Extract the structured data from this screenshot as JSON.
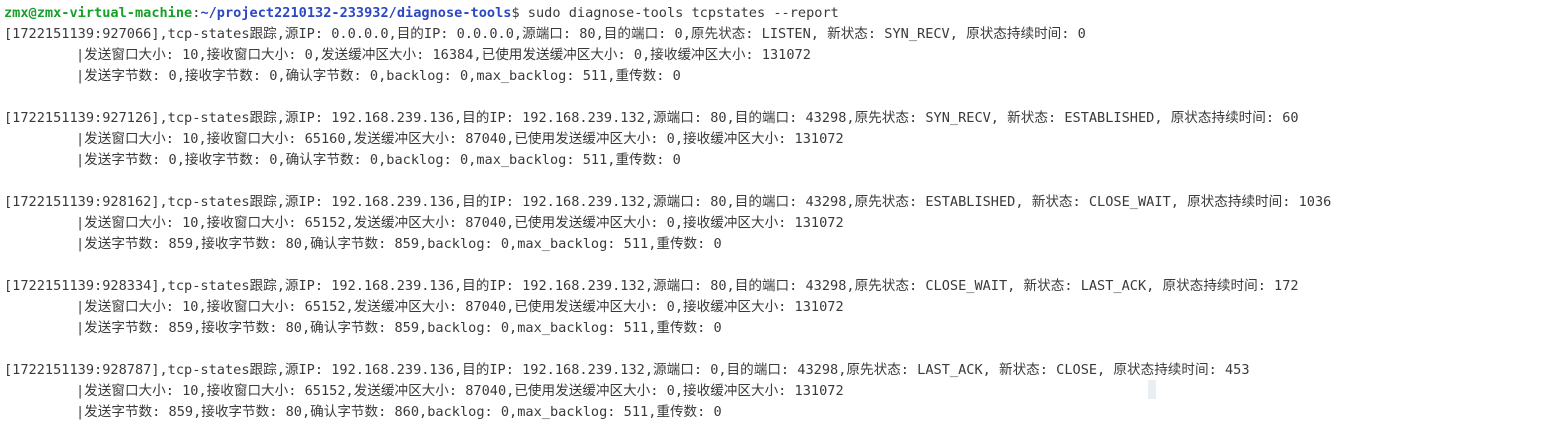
{
  "prompt": {
    "user_host": "zmx@zmx-virtual-machine",
    "separator": ":",
    "path": "~/project2210132-233932/diagnose-tools",
    "dollar": "$",
    "command": " sudo diagnose-tools tcpstates --report"
  },
  "entries": [
    {
      "header": "[1722151139:927066],tcp-states跟踪,源IP: 0.0.0.0,目的IP: 0.0.0.0,源端口: 80,目的端口: 0,原先状态: LISTEN, 新状态: SYN_RECV, 原状态持续时间: 0",
      "window": "|发送窗口大小: 10,接收窗口大小: 0,发送缓冲区大小: 16384,已使用发送缓冲区大小: 0,接收缓冲区大小: 131072",
      "bytes": "|发送字节数: 0,接收字节数: 0,确认字节数: 0,backlog: 0,max_backlog: 511,重传数: 0"
    },
    {
      "header": "[1722151139:927126],tcp-states跟踪,源IP: 192.168.239.136,目的IP: 192.168.239.132,源端口: 80,目的端口: 43298,原先状态: SYN_RECV, 新状态: ESTABLISHED, 原状态持续时间: 60",
      "window": "|发送窗口大小: 10,接收窗口大小: 65160,发送缓冲区大小: 87040,已使用发送缓冲区大小: 0,接收缓冲区大小: 131072",
      "bytes": "|发送字节数: 0,接收字节数: 0,确认字节数: 0,backlog: 0,max_backlog: 511,重传数: 0"
    },
    {
      "header": "[1722151139:928162],tcp-states跟踪,源IP: 192.168.239.136,目的IP: 192.168.239.132,源端口: 80,目的端口: 43298,原先状态: ESTABLISHED, 新状态: CLOSE_WAIT, 原状态持续时间: 1036",
      "window": "|发送窗口大小: 10,接收窗口大小: 65152,发送缓冲区大小: 87040,已使用发送缓冲区大小: 0,接收缓冲区大小: 131072",
      "bytes": "|发送字节数: 859,接收字节数: 80,确认字节数: 859,backlog: 0,max_backlog: 511,重传数: 0"
    },
    {
      "header": "[1722151139:928334],tcp-states跟踪,源IP: 192.168.239.136,目的IP: 192.168.239.132,源端口: 80,目的端口: 43298,原先状态: CLOSE_WAIT, 新状态: LAST_ACK, 原状态持续时间: 172",
      "window": "|发送窗口大小: 10,接收窗口大小: 65152,发送缓冲区大小: 87040,已使用发送缓冲区大小: 0,接收缓冲区大小: 131072",
      "bytes": "|发送字节数: 859,接收字节数: 80,确认字节数: 859,backlog: 0,max_backlog: 511,重传数: 0"
    },
    {
      "header": "[1722151139:928787],tcp-states跟踪,源IP: 192.168.239.136,目的IP: 192.168.239.132,源端口: 0,目的端口: 43298,原先状态: LAST_ACK, 新状态: CLOSE, 原状态持续时间: 453",
      "window": "|发送窗口大小: 10,接收窗口大小: 65152,发送缓冲区大小: 87040,已使用发送缓冲区大小: 0,接收缓冲区大小: 131072",
      "bytes": "|发送字节数: 859,接收字节数: 80,确认字节数: 860,backlog: 0,max_backlog: 511,重传数: 0"
    }
  ],
  "colors": {
    "background": "#ffffff",
    "text": "#3a3a3a",
    "prompt_user": "#17a02a",
    "prompt_path": "#2b47c4"
  }
}
